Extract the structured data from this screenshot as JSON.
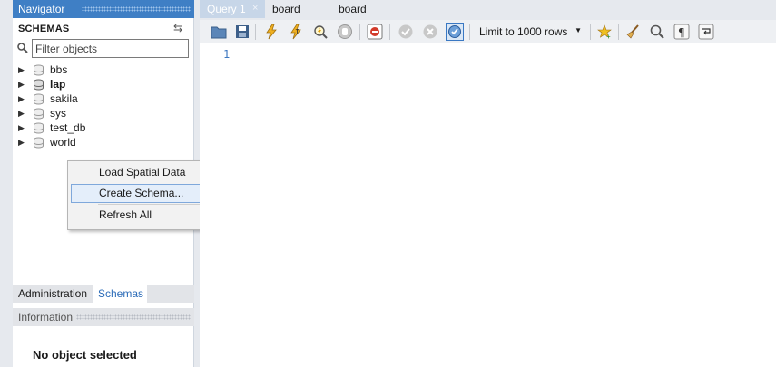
{
  "navigator": {
    "title": "Navigator",
    "schemas_title": "SCHEMAS",
    "filter_placeholder": "Filter objects",
    "schemas": [
      {
        "name": "bbs",
        "bold": false
      },
      {
        "name": "lap",
        "bold": true
      },
      {
        "name": "sakila",
        "bold": false
      },
      {
        "name": "sys",
        "bold": false
      },
      {
        "name": "test_db",
        "bold": false
      },
      {
        "name": "world",
        "bold": false
      }
    ],
    "tabs": {
      "administration": "Administration",
      "schemas": "Schemas"
    },
    "info_title": "Information",
    "no_object": "No object selected"
  },
  "context_menu": {
    "items": [
      "Load Spatial Data",
      "Create Schema...",
      "Refresh All"
    ],
    "highlighted_index": 1
  },
  "editor": {
    "tabs": [
      {
        "label": "Query 1",
        "active": true
      },
      {
        "label": "board",
        "active": false
      },
      {
        "label": "board",
        "active": false
      }
    ],
    "limit_label": "Limit to 1000 rows",
    "line_number": "1"
  },
  "colors": {
    "navigator_header": "#3f7fc5",
    "active_tab": "#c7d6e8",
    "menu_highlight": "#e4eefa",
    "schemas_tab_text": "#2c6cb8"
  }
}
